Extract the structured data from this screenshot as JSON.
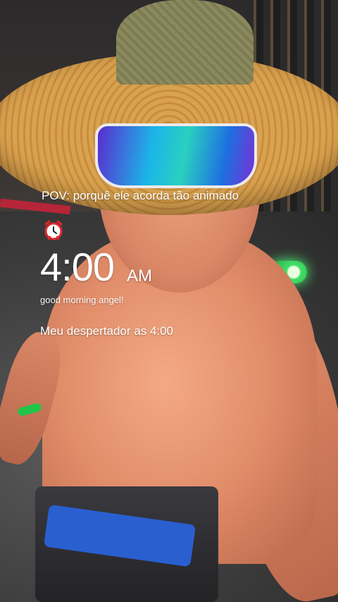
{
  "overlay": {
    "pov_text": "POV: porquê ele acorda tão animado",
    "alarm_icon": "alarm-clock-icon",
    "time": "4:00",
    "ampm": "AM",
    "subtitle": "good morning angel!",
    "caption": "Meu despertador as 4:00"
  },
  "colors": {
    "alarm_red": "#e0282e",
    "text": "#ffffff"
  }
}
